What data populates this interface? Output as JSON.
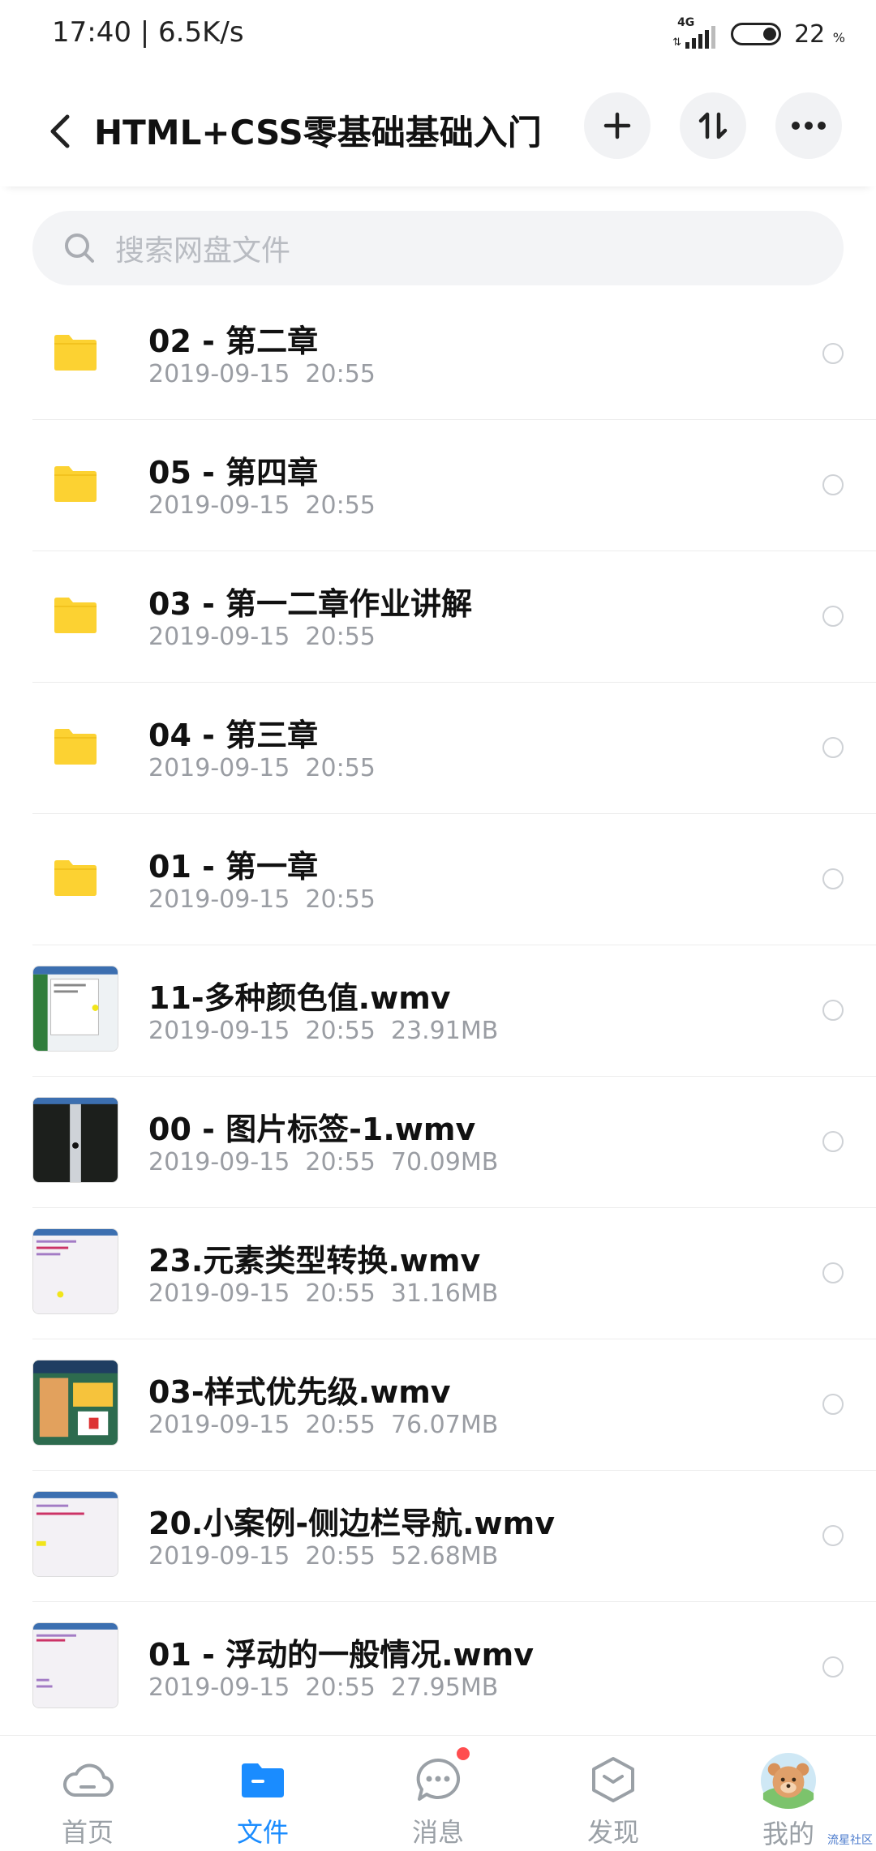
{
  "status": {
    "time": "17:40 | 6.5K/s",
    "network": "4G",
    "battery_pct": "22",
    "battery_unit": "%"
  },
  "header": {
    "title": "HTML+CSS零基础基础入门"
  },
  "search": {
    "placeholder": "搜索网盘文件"
  },
  "files": [
    {
      "name": "02 - 第二章",
      "meta": "2019-09-15  20:55",
      "kind": "folder"
    },
    {
      "name": "05 - 第四章",
      "meta": "2019-09-15  20:55",
      "kind": "folder"
    },
    {
      "name": "03 - 第一二章作业讲解",
      "meta": "2019-09-15  20:55",
      "kind": "folder"
    },
    {
      "name": "04 - 第三章",
      "meta": "2019-09-15  20:55",
      "kind": "folder"
    },
    {
      "name": "01 - 第一章",
      "meta": "2019-09-15  20:55",
      "kind": "folder"
    },
    {
      "name": "11-多种颜色值.wmv",
      "meta": "2019-09-15  20:55  23.91MB",
      "kind": "video"
    },
    {
      "name": "00 - 图片标签-1.wmv",
      "meta": "2019-09-15  20:55  70.09MB",
      "kind": "video"
    },
    {
      "name": "23.元素类型转换.wmv",
      "meta": "2019-09-15  20:55  31.16MB",
      "kind": "video"
    },
    {
      "name": "03-样式优先级.wmv",
      "meta": "2019-09-15  20:55  76.07MB",
      "kind": "video"
    },
    {
      "name": "20.小案例-侧边栏导航.wmv",
      "meta": "2019-09-15  20:55  52.68MB",
      "kind": "video"
    },
    {
      "name": "01 - 浮动的一般情况.wmv",
      "meta": "2019-09-15  20:55  27.95MB",
      "kind": "video"
    }
  ],
  "tabs": [
    {
      "label": "首页",
      "icon": "cloud-icon",
      "active": false
    },
    {
      "label": "文件",
      "icon": "folder-icon",
      "active": true
    },
    {
      "label": "消息",
      "icon": "message-icon",
      "active": false
    },
    {
      "label": "发现",
      "icon": "discover-icon",
      "active": false
    },
    {
      "label": "我的",
      "icon": "avatar",
      "active": false
    }
  ],
  "watermark": "流星社区",
  "colors": {
    "accent": "#1a8cff",
    "folder": "#fcd232",
    "badge": "#ff4d4f"
  }
}
